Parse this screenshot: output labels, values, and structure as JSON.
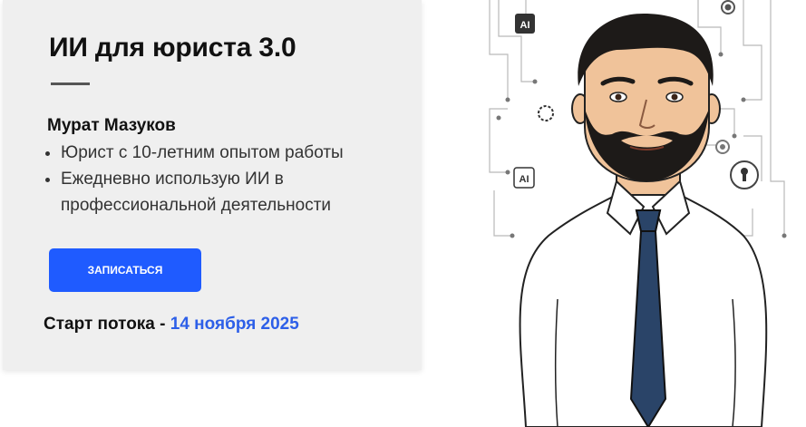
{
  "course": {
    "title": "ИИ для юриста 3.0",
    "author": "Мурат Мазуков",
    "bullets": [
      "Юрист с 10-летним опытом работы",
      "Ежедневно использую ИИ в профессиональной деятельности"
    ],
    "cta_label": "ЗАПИСАТЬСЯ",
    "start_label": "Старт потока -",
    "start_date": "14 ноября 2025"
  },
  "illustration": {
    "badge_1": "AI",
    "badge_2": "AI"
  },
  "colors": {
    "accent": "#1f5bff",
    "date": "#2d5fe8",
    "card_bg": "#efefef"
  }
}
